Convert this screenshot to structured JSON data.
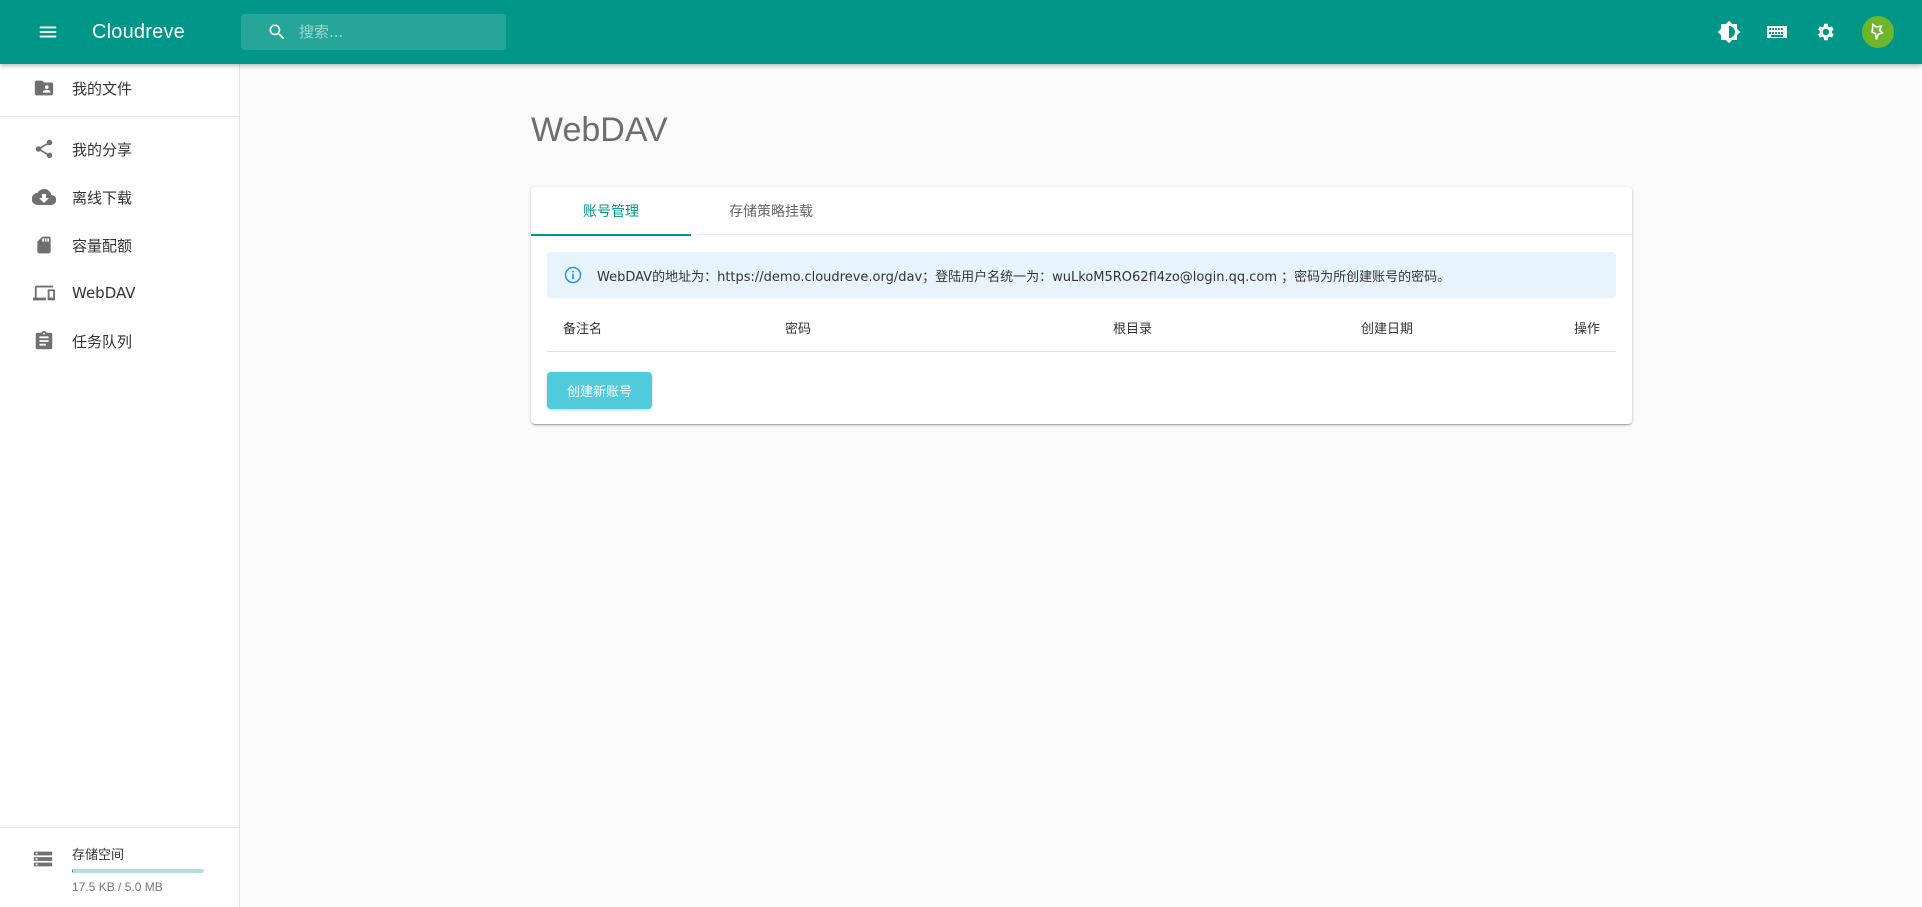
{
  "appbar": {
    "title": "Cloudreve",
    "search_placeholder": "搜索..."
  },
  "sidebar": {
    "items": [
      {
        "label": "我的文件",
        "icon": "folder-user-icon"
      },
      {
        "label": "我的分享",
        "icon": "share-icon"
      },
      {
        "label": "离线下载",
        "icon": "cloud-download-icon"
      },
      {
        "label": "容量配额",
        "icon": "sd-card-icon"
      },
      {
        "label": "WebDAV",
        "icon": "devices-icon"
      },
      {
        "label": "任务队列",
        "icon": "clipboard-icon"
      }
    ],
    "storage": {
      "title": "存储空间",
      "usage": "17.5 KB / 5.0 MB",
      "used_fraction": 0.0034
    }
  },
  "main": {
    "page_title": "WebDAV",
    "tabs": [
      {
        "label": "账号管理",
        "active": true
      },
      {
        "label": "存储策略挂载",
        "active": false
      }
    ],
    "info_text": "WebDAV的地址为：https://demo.cloudreve.org/dav；登陆用户名统一为：wuLkoM5RO62fl4zo@login.qq.com ；密码为所创建账号的密码。",
    "table_headers": [
      "备注名",
      "密码",
      "根目录",
      "创建日期",
      "操作"
    ],
    "create_button": "创建新账号"
  },
  "colors": {
    "primary": "#009688",
    "button": "#4fcbdc",
    "info_bg": "#e8f4fd",
    "info_icon": "#2196f3"
  }
}
